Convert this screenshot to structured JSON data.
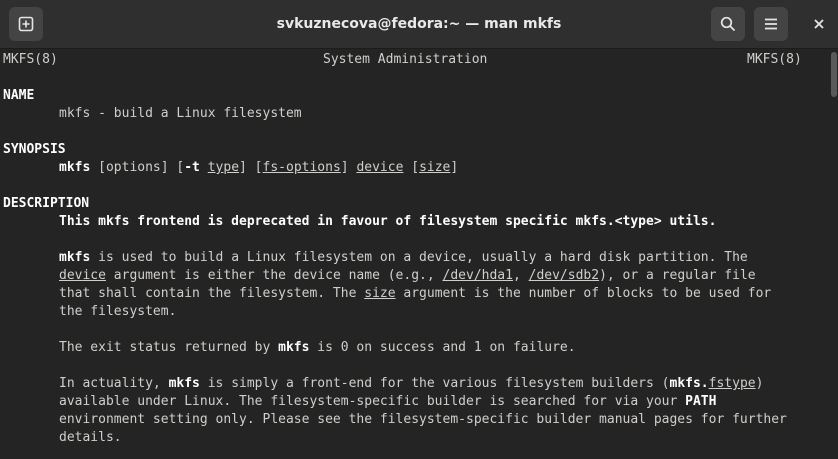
{
  "window": {
    "title": "svkuznecova@fedora:~ — man mkfs",
    "new_tab_icon": "new-tab-icon",
    "search_icon": "search-icon",
    "menu_icon": "hamburger-menu-icon",
    "close_icon": "close-icon"
  },
  "man": {
    "header": {
      "left": "MKFS(8)",
      "center": "System Administration",
      "right": "MKFS(8)"
    },
    "name_heading": "NAME",
    "name_text": "mkfs - build a Linux filesystem",
    "synopsis_heading": "SYNOPSIS",
    "synopsis": {
      "cmd": "mkfs",
      "t1": " [options] [",
      "flag": "-t",
      "t2": " ",
      "type": "type",
      "t3": "] [",
      "fs_options": "fs-options",
      "t4": "] ",
      "device": "device",
      "t5": " [",
      "size": "size",
      "t6": "]"
    },
    "description_heading": "DESCRIPTION",
    "deprecated": "This mkfs frontend is deprecated in favour of filesystem specific mkfs.<type> utils.",
    "p1": {
      "l1_cmd": "mkfs",
      "l1_rest": " is used to build a Linux filesystem on a device, usually a hard disk partition. The",
      "l2_device": "device",
      "l2_a": " argument is either the device name (e.g., ",
      "l2_hda1": "/dev/hda1",
      "l2_b": ", ",
      "l2_sdb2": "/dev/sdb2",
      "l2_c": "), or a regular file",
      "l3_a": "that shall contain the filesystem. The ",
      "l3_size": "size",
      "l3_b": " argument is the number of blocks to be used for",
      "l4": "the filesystem."
    },
    "p2": {
      "a": "The exit status returned by ",
      "cmd": "mkfs",
      "b": " is 0 on success and 1 on failure."
    },
    "p3": {
      "l1_a": "In actuality, ",
      "l1_cmd": "mkfs",
      "l1_b": " is simply a front-end for the various filesystem builders (",
      "l1_mkfs_dot": "mkfs.",
      "l1_fstype": "fstype",
      "l1_c": ")",
      "l2_a": "available under Linux. The filesystem-specific builder is searched for via your ",
      "l2_path": "PATH",
      "l3": "environment setting only. Please see the filesystem-specific builder manual pages for further",
      "l4": "details."
    }
  }
}
